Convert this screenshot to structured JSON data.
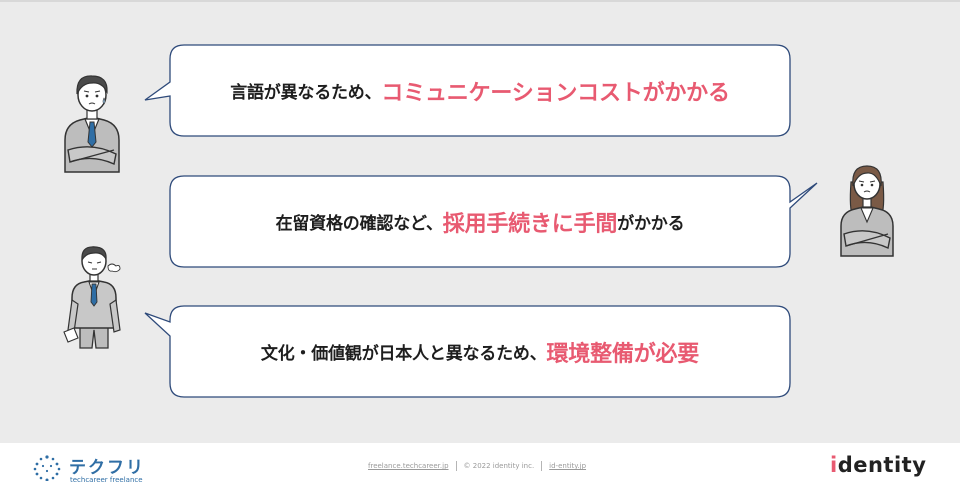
{
  "bubbles": [
    {
      "prefix": "言語が異なるため、",
      "highlight": "コミュニケーションコスト",
      "suffix": "がかかる"
    },
    {
      "prefix": "在留資格の確認など、",
      "highlight": "採用手続きに手間",
      "suffix": "がかかる"
    },
    {
      "prefix": "文化・価値観が日本人と異なるため、",
      "highlight": "環境整備が必要",
      "suffix": ""
    }
  ],
  "footer": {
    "brand_name": "テクフリ",
    "brand_sub": "techcareer freelance",
    "link1": "freelance.techcareer.jp",
    "copyright": "© 2022 identity inc.",
    "link2": "id-entity.jp",
    "brand_right_i": "i",
    "brand_right_rest": "dentity"
  },
  "icons": {
    "person_1": "worried-businessman-arms-crossed",
    "person_2": "worried-businesswoman-arms-crossed",
    "person_3": "sighing-businessman-holding-paper"
  },
  "colors": {
    "highlight": "#e85a71",
    "bubble_border": "#2e4a7a",
    "background": "#ebebeb",
    "brand_blue": "#2f6ea5"
  }
}
